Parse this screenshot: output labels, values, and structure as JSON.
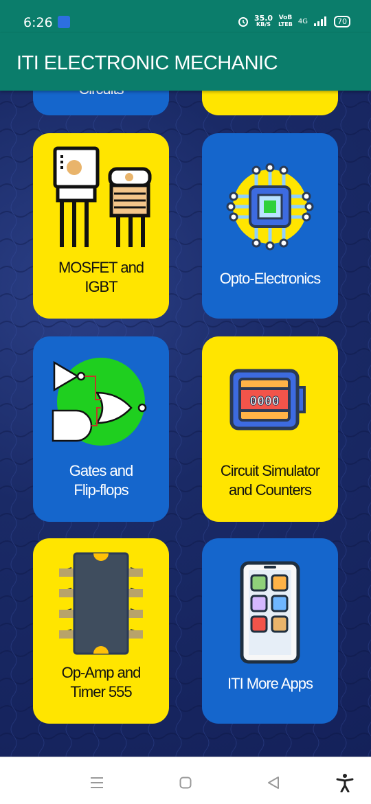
{
  "status_bar": {
    "time": "6:26",
    "speed_value": "35.0",
    "speed_unit": "KB/S",
    "volte_top": "VoB",
    "volte_bottom": "LTEB",
    "network": "4G",
    "battery": "70"
  },
  "app_bar": {
    "title": "ITI ELECTRONIC MECHANIC"
  },
  "tiles": [
    {
      "label": "Circuits",
      "color": "blue"
    },
    {
      "label": "",
      "color": "yellow"
    },
    {
      "label": "MOSFET and IGBT",
      "line1": "MOSFET and",
      "line2": "IGBT",
      "color": "yellow",
      "icon": "mosfet-icon"
    },
    {
      "label": "Opto-Electronics",
      "line1": "Opto-Electronics",
      "color": "blue",
      "icon": "chip-icon"
    },
    {
      "label": "Gates and Flip-flops",
      "line1": "Gates and",
      "line2": "Flip-flops",
      "color": "blue",
      "icon": "logic-gates-icon"
    },
    {
      "label": "Circuit Simulator and Counters",
      "line1": "Circuit Simulator",
      "line2": "and Counters",
      "color": "yellow",
      "icon": "counter-icon"
    },
    {
      "label": "Op-Amp and Timer 555",
      "line1": "Op-Amp and",
      "line2": "Timer 555",
      "color": "yellow",
      "icon": "ic-chip-icon"
    },
    {
      "label": "ITI More Apps",
      "line1": "ITI More Apps",
      "color": "blue",
      "icon": "phone-apps-icon"
    }
  ],
  "counter_display": "0000",
  "colors": {
    "primary": "#0b7d6b",
    "tile_yellow": "#ffe500",
    "tile_blue": "#1566cc",
    "background": "#1a2a66"
  },
  "nav": {
    "items": [
      "menu-icon",
      "home-icon",
      "back-icon",
      "accessibility-icon"
    ]
  }
}
